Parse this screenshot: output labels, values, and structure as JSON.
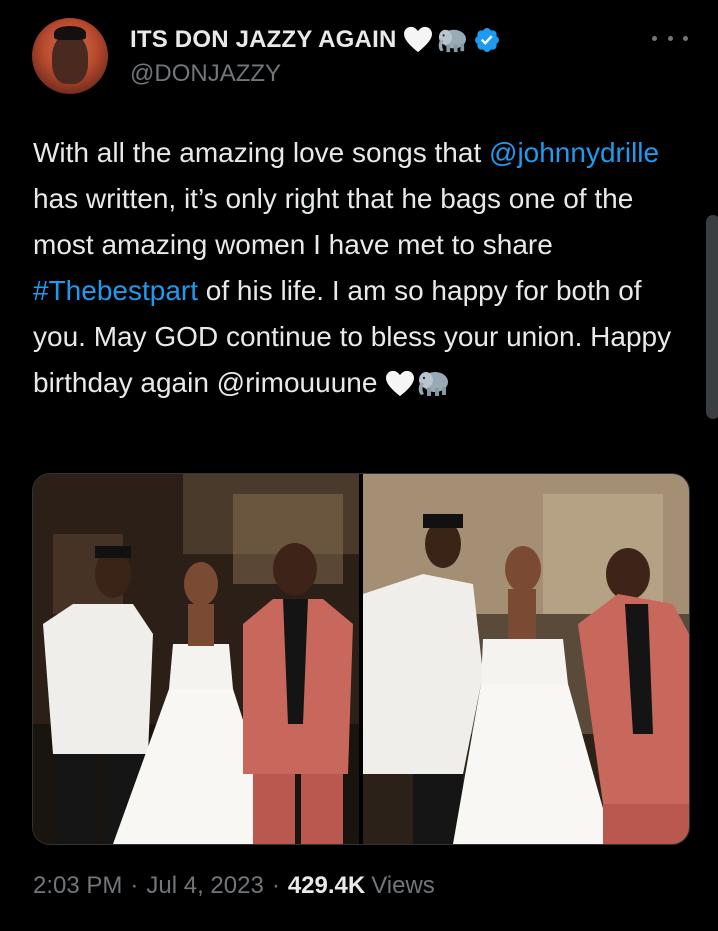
{
  "author": {
    "display_name": "ITS DON JAZZY AGAIN",
    "handle": "@DONJAZZY",
    "verified": true
  },
  "tweet": {
    "segments": [
      {
        "text": "With all the amazing love songs that ",
        "type": "text"
      },
      {
        "text": "@johnnydrille",
        "type": "mention"
      },
      {
        "text": " has written, it’s only right that he bags one of the most amazing women I have met to share ",
        "type": "text"
      },
      {
        "text": "#Thebestpart",
        "type": "hashtag"
      },
      {
        "text": " of his life. I am so happy for both of you. May GOD continue to bless your union. Happy birthday again @rimouuune ",
        "type": "text"
      }
    ],
    "trailing_emojis": [
      "white-heart",
      "elephant"
    ]
  },
  "media": {
    "count": 2
  },
  "meta": {
    "time": "2:03 PM",
    "date": "Jul 4, 2023",
    "views_count": "429.4K",
    "views_label": "Views",
    "separator": "·"
  },
  "icons": {
    "more": "more-icon",
    "verified": "verified-badge-icon",
    "heart": "white-heart-emoji",
    "elephant": "elephant-emoji"
  },
  "colors": {
    "background": "#000000",
    "text": "#e7e9ea",
    "secondary": "#71767b",
    "link": "#1d9bf0",
    "border": "#2f3336"
  }
}
